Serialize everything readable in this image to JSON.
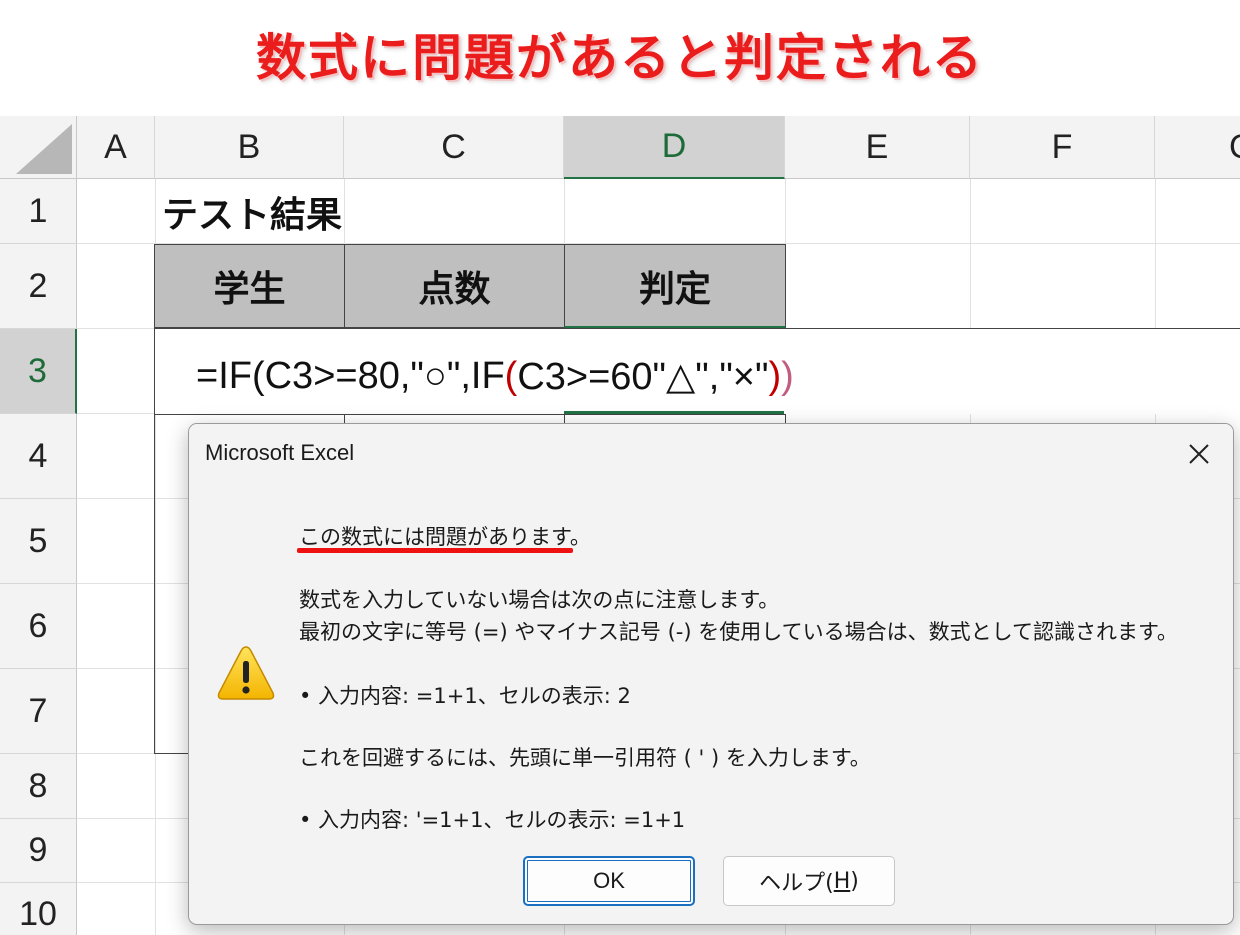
{
  "banner": {
    "text": "数式に問題があると判定される",
    "color": "#ea1c1c"
  },
  "sheet": {
    "columns": [
      "A",
      "B",
      "C",
      "D",
      "E",
      "F",
      "G"
    ],
    "rows": [
      "1",
      "2",
      "3",
      "4",
      "5",
      "6",
      "7",
      "8",
      "9",
      "10"
    ],
    "selected_column": "D",
    "selected_row": "3",
    "title_cell": "テスト結果",
    "table_headers": [
      "学生",
      "点数",
      "判定"
    ],
    "formula": {
      "part1": "=IF(C3>=80,\"○\",IF",
      "paren_open": "(",
      "part2": "C3>=60\"△\",\"×\"",
      "paren_close_inner": ")",
      "paren_close_outer": ")"
    },
    "accent_color": "#217346"
  },
  "dialog": {
    "title": "Microsoft Excel",
    "close_icon": "close-icon",
    "heading": "この数式には問題があります。",
    "line1": "数式を入力していない場合は次の点に注意します。",
    "line2": "最初の文字に等号 (=) やマイナス記号 (-) を使用している場合は、数式として認識されます。",
    "bullet1": "•  入力内容: =1+1、セルの表示: 2",
    "line3": "これを回避するには、先頭に単一引用符 ( ' ) を入力します。",
    "bullet2": "•  入力内容: '=1+1、セルの表示: =1+1",
    "icon": "warning-icon",
    "ok_label": "OK",
    "help_label_main": "ヘルプ(",
    "help_label_accel": "H",
    "help_label_end": ")",
    "highlight_color": "#ee1111"
  }
}
